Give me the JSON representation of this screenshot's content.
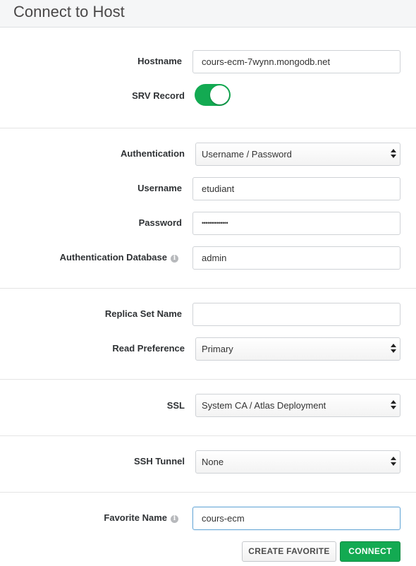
{
  "header": {
    "title": "Connect to Host"
  },
  "fields": {
    "hostname": {
      "label": "Hostname",
      "value": "cours-ecm-7wynn.mongodb.net"
    },
    "srv_record": {
      "label": "SRV Record",
      "enabled": true
    },
    "authentication": {
      "label": "Authentication",
      "selected": "Username / Password"
    },
    "username": {
      "label": "Username",
      "value": "etudiant"
    },
    "password": {
      "label": "Password",
      "masked": "••••••••••••••"
    },
    "auth_database": {
      "label": "Authentication Database",
      "value": "admin",
      "info_icon": "info-icon"
    },
    "replica_set_name": {
      "label": "Replica Set Name",
      "value": ""
    },
    "read_preference": {
      "label": "Read Preference",
      "selected": "Primary"
    },
    "ssl": {
      "label": "SSL",
      "selected": "System CA / Atlas Deployment"
    },
    "ssh_tunnel": {
      "label": "SSH Tunnel",
      "selected": "None"
    },
    "favorite_name": {
      "label": "Favorite Name",
      "value": "cours-ecm",
      "info_icon": "info-icon"
    }
  },
  "buttons": {
    "create_favorite": "CREATE FAVORITE",
    "connect": "CONNECT"
  },
  "colors": {
    "accent_green": "#13aa52",
    "focus_border": "#6ba9d6"
  }
}
